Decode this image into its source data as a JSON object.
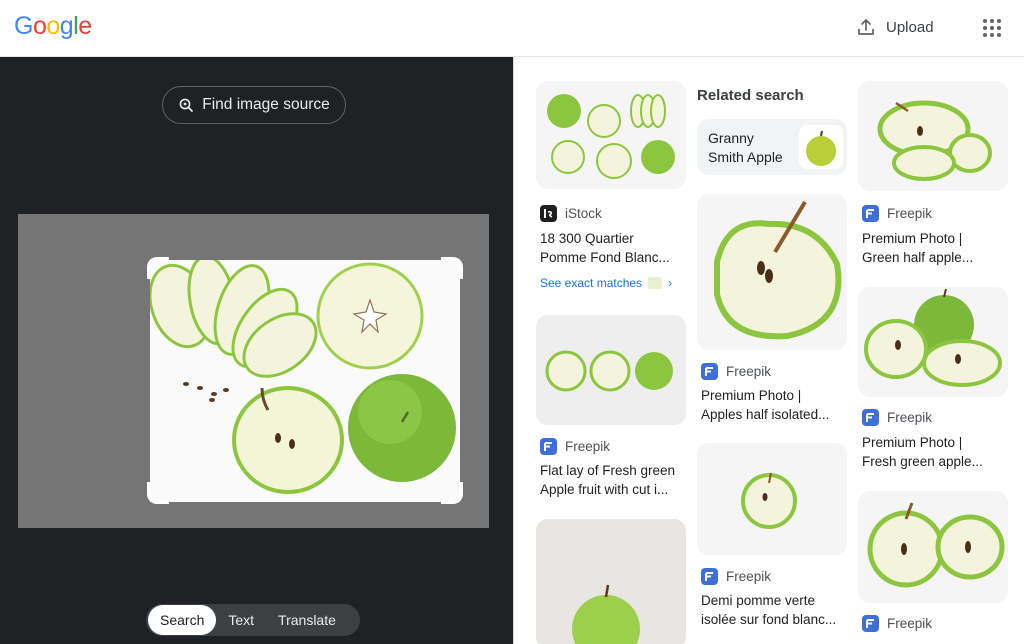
{
  "header": {
    "logo_letters": [
      {
        "ch": "G",
        "color": "#4285F4"
      },
      {
        "ch": "o",
        "color": "#EA4335"
      },
      {
        "ch": "o",
        "color": "#FBBC05"
      },
      {
        "ch": "g",
        "color": "#4285F4"
      },
      {
        "ch": "l",
        "color": "#34A853"
      },
      {
        "ch": "e",
        "color": "#EA4335"
      }
    ],
    "upload_label": "Upload",
    "upload_icon": "upload-icon",
    "apps_icon": "apps-grid-icon"
  },
  "lens": {
    "find_source_label": "Find image source",
    "modes": [
      "Search",
      "Text",
      "Translate"
    ],
    "active_mode": "Search"
  },
  "results": {
    "col1": [
      {
        "source": "iStock",
        "title": [
          "18 300 Quartier",
          "Pomme Fond Blanc..."
        ],
        "exact_matches": "See exact matches"
      },
      {
        "source": "Freepik",
        "title": [
          "Flat lay of Fresh green",
          "Apple fruit with cut i..."
        ]
      },
      {
        "source": "",
        "title": []
      }
    ],
    "related": {
      "heading": "Related search",
      "chip_lines": [
        "Granny",
        "Smith Apple"
      ]
    },
    "col2": [
      {
        "source": "Freepik",
        "title": [
          "Premium Photo |",
          "Apples half isolated..."
        ]
      },
      {
        "source": "Freepik",
        "title": [
          "Demi pomme verte",
          "isolée sur fond blanc..."
        ]
      }
    ],
    "col3": [
      {
        "source": "Freepik",
        "title": [
          "Premium Photo |",
          "Green half apple..."
        ]
      },
      {
        "source": "Freepik",
        "title": [
          "Premium Photo |",
          "Fresh green apple..."
        ]
      },
      {
        "source": "Freepik",
        "title": []
      }
    ]
  },
  "colors": {
    "apple_green": "#8cc63f",
    "apple_flesh": "#f4f4dc",
    "freepik_blue": "#3e6fd8",
    "link_blue": "#1a73e8"
  }
}
